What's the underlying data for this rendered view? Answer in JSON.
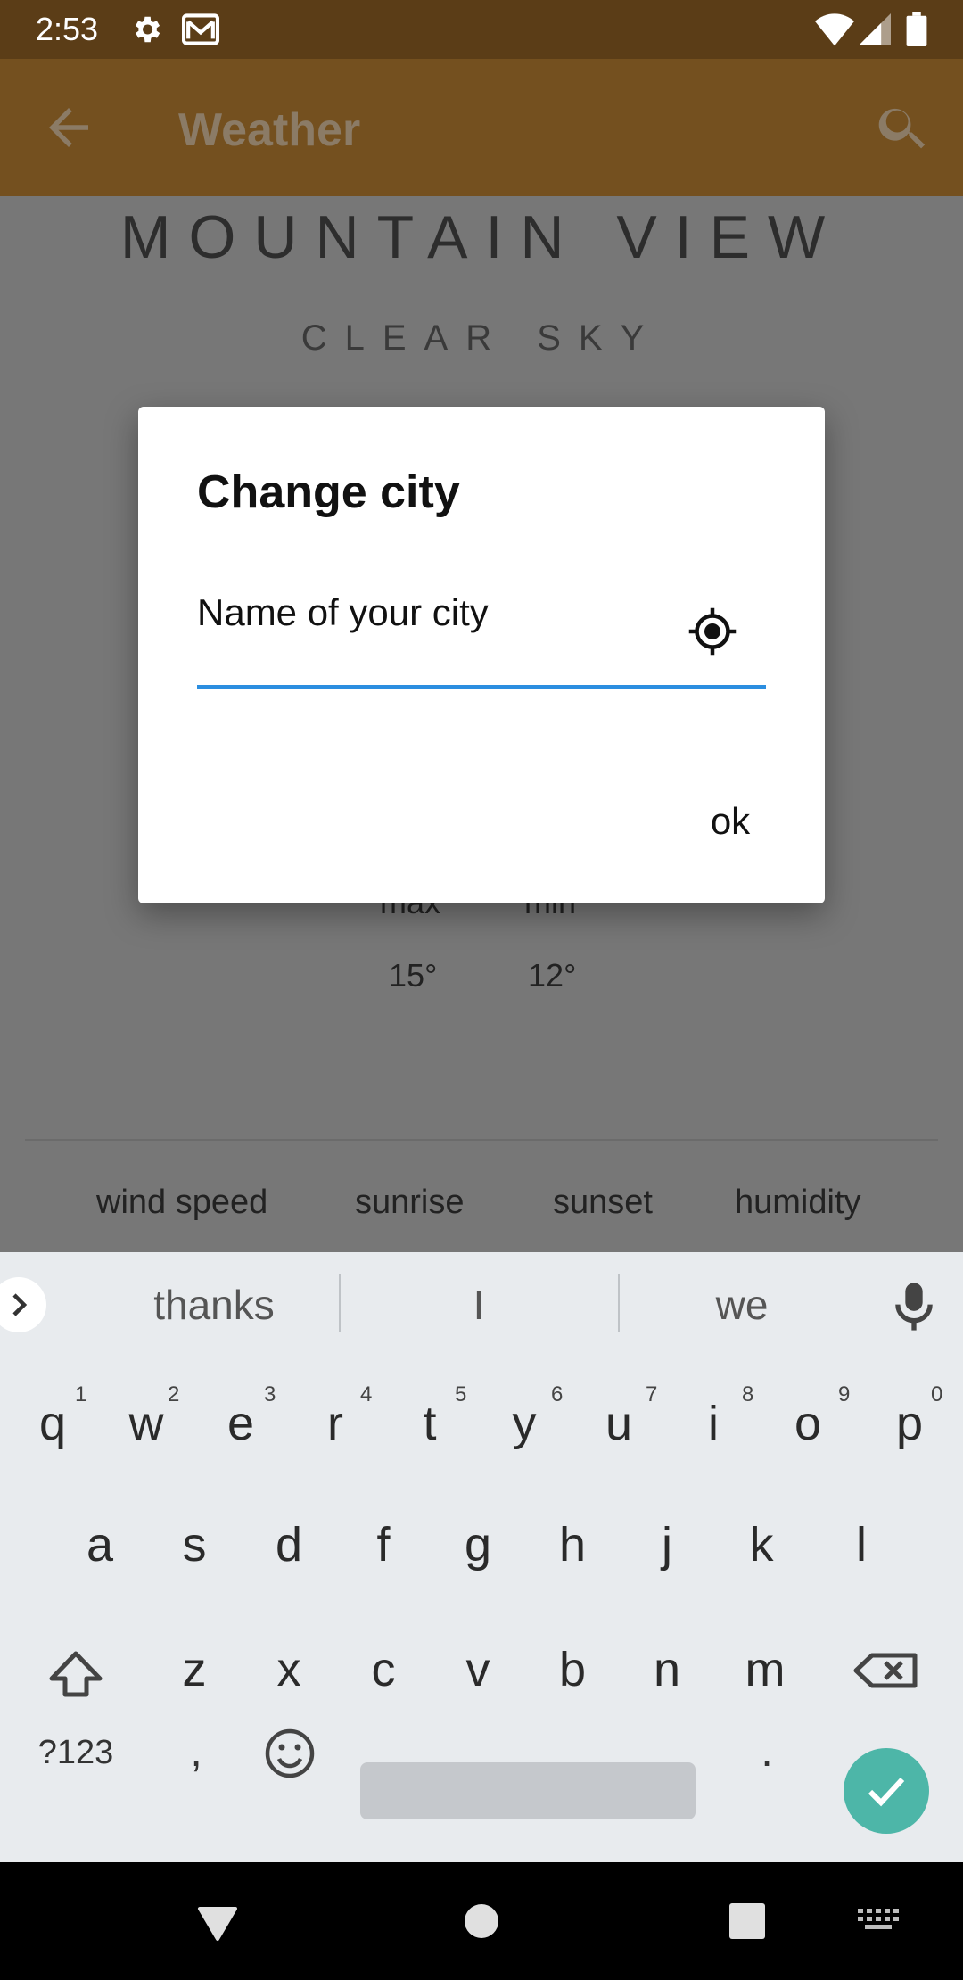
{
  "status_bar": {
    "time": "2:53",
    "icons": [
      "gear-icon",
      "mail-icon",
      "wifi-icon",
      "signal-icon",
      "battery-icon"
    ]
  },
  "app_bar": {
    "title": "Weather",
    "back_icon": "arrow-back-icon",
    "search_icon": "search-icon",
    "color": "#74501f"
  },
  "weather": {
    "city": "MOUNTAIN VIEW",
    "condition": "CLEAR SKY",
    "max_label": "max",
    "min_label": "min",
    "max_value": "15°",
    "min_value": "12°",
    "stats": [
      "wind speed",
      "sunrise",
      "sunset",
      "humidity"
    ]
  },
  "dialog": {
    "title": "Change city",
    "input_placeholder": "Name of your city",
    "input_value": "",
    "locate_icon": "my-location-icon",
    "ok_label": "ok",
    "accent_color": "#2b8ee0"
  },
  "keyboard": {
    "suggestions": [
      "thanks",
      "I",
      "we"
    ],
    "row1": [
      "q",
      "w",
      "e",
      "r",
      "t",
      "y",
      "u",
      "i",
      "o",
      "p"
    ],
    "row1_hints": [
      "1",
      "2",
      "3",
      "4",
      "5",
      "6",
      "7",
      "8",
      "9",
      "0"
    ],
    "row2": [
      "a",
      "s",
      "d",
      "f",
      "g",
      "h",
      "j",
      "k",
      "l"
    ],
    "row3": [
      "z",
      "x",
      "c",
      "v",
      "b",
      "n",
      "m"
    ],
    "symbols_label": "?123",
    "comma": ",",
    "period": ".",
    "enter_color": "#4db6a8"
  }
}
